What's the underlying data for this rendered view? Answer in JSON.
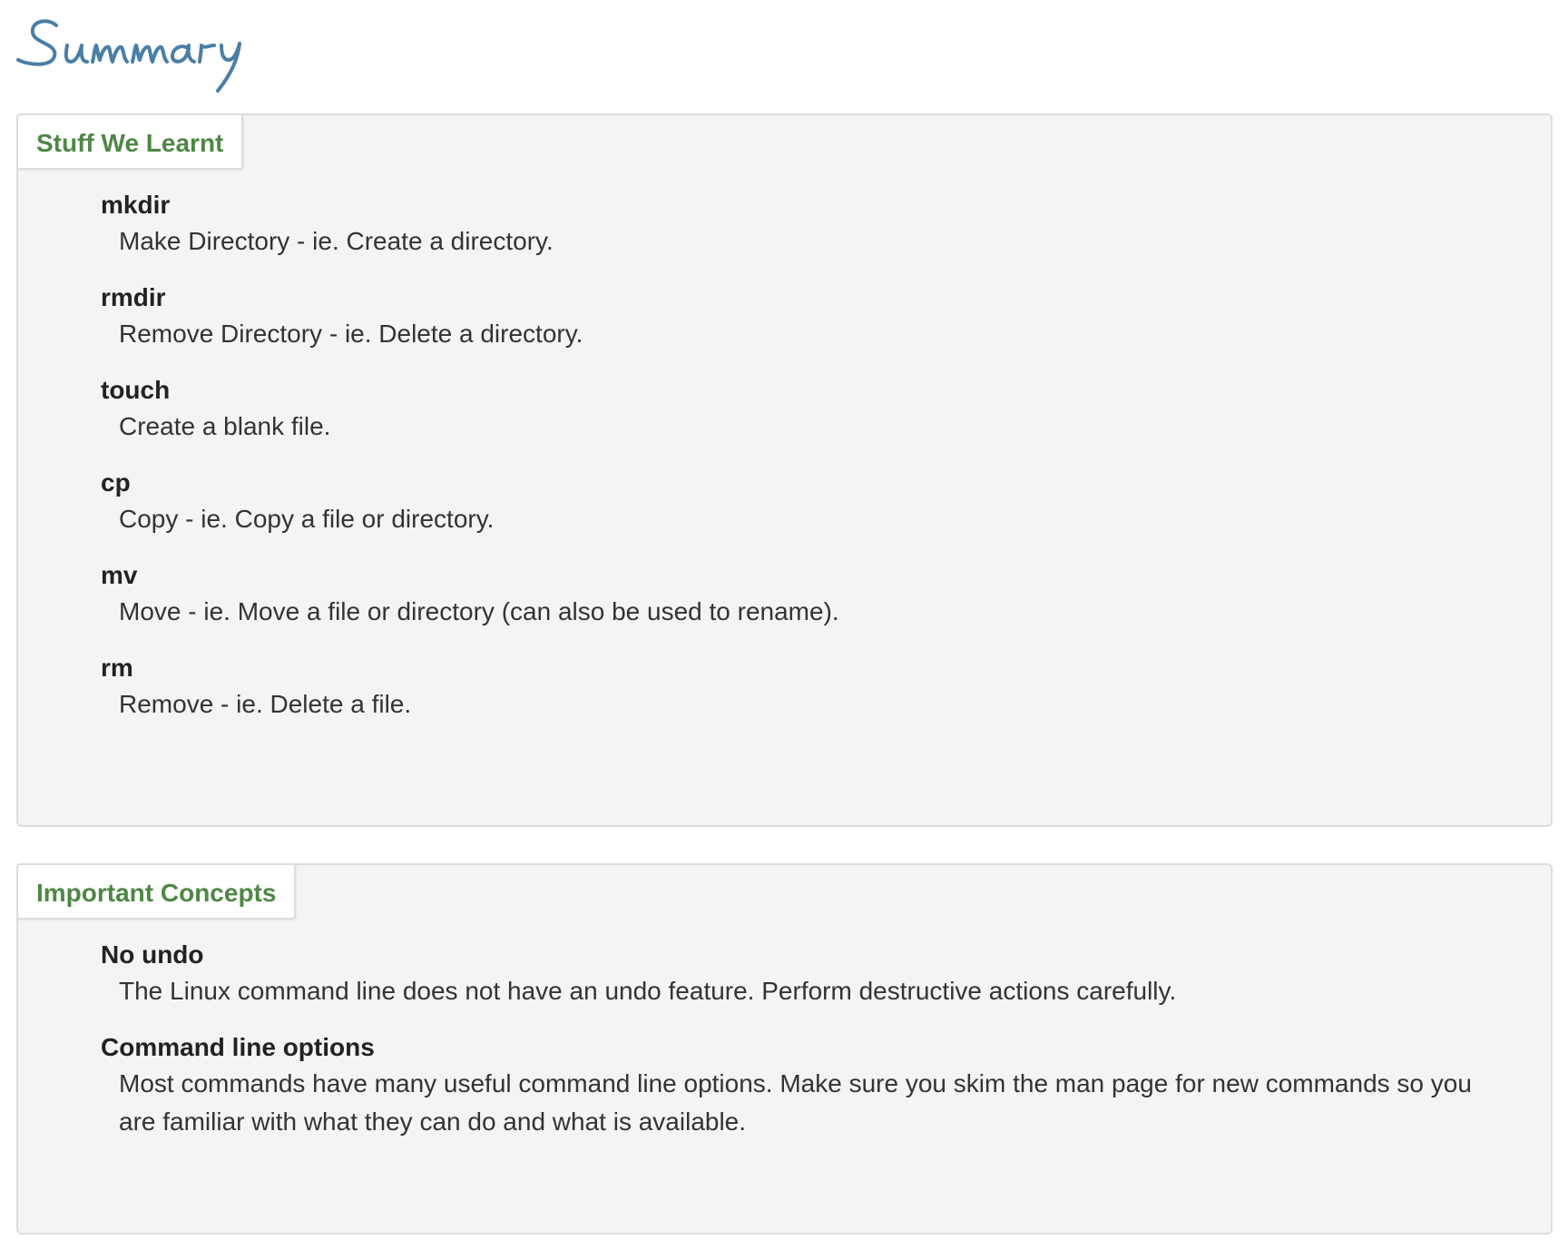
{
  "page": {
    "title": "Summary",
    "title_color": "#4a7ea6"
  },
  "panels": [
    {
      "label": "Stuff We Learnt",
      "items": [
        {
          "term": "mkdir",
          "description": "Make Directory - ie. Create a directory."
        },
        {
          "term": "rmdir",
          "description": "Remove Directory - ie. Delete a directory."
        },
        {
          "term": "touch",
          "description": "Create a blank file."
        },
        {
          "term": "cp",
          "description": "Copy - ie. Copy a file or directory."
        },
        {
          "term": "mv",
          "description": "Move - ie. Move a file or directory (can also be used to rename)."
        },
        {
          "term": "rm",
          "description": "Remove - ie. Delete a file."
        }
      ]
    },
    {
      "label": "Important Concepts",
      "items": [
        {
          "term": "No undo",
          "description": "The Linux command line does not have an undo feature. Perform destructive actions carefully."
        },
        {
          "term": "Command line options",
          "description": "Most commands have many useful command line options. Make sure you skim the man page for new commands so you are familiar with what they can do and what is available."
        }
      ]
    }
  ],
  "colors": {
    "panel_label": "#4e8745",
    "panel_background": "#f4f4f4",
    "panel_border": "#dddddd"
  }
}
